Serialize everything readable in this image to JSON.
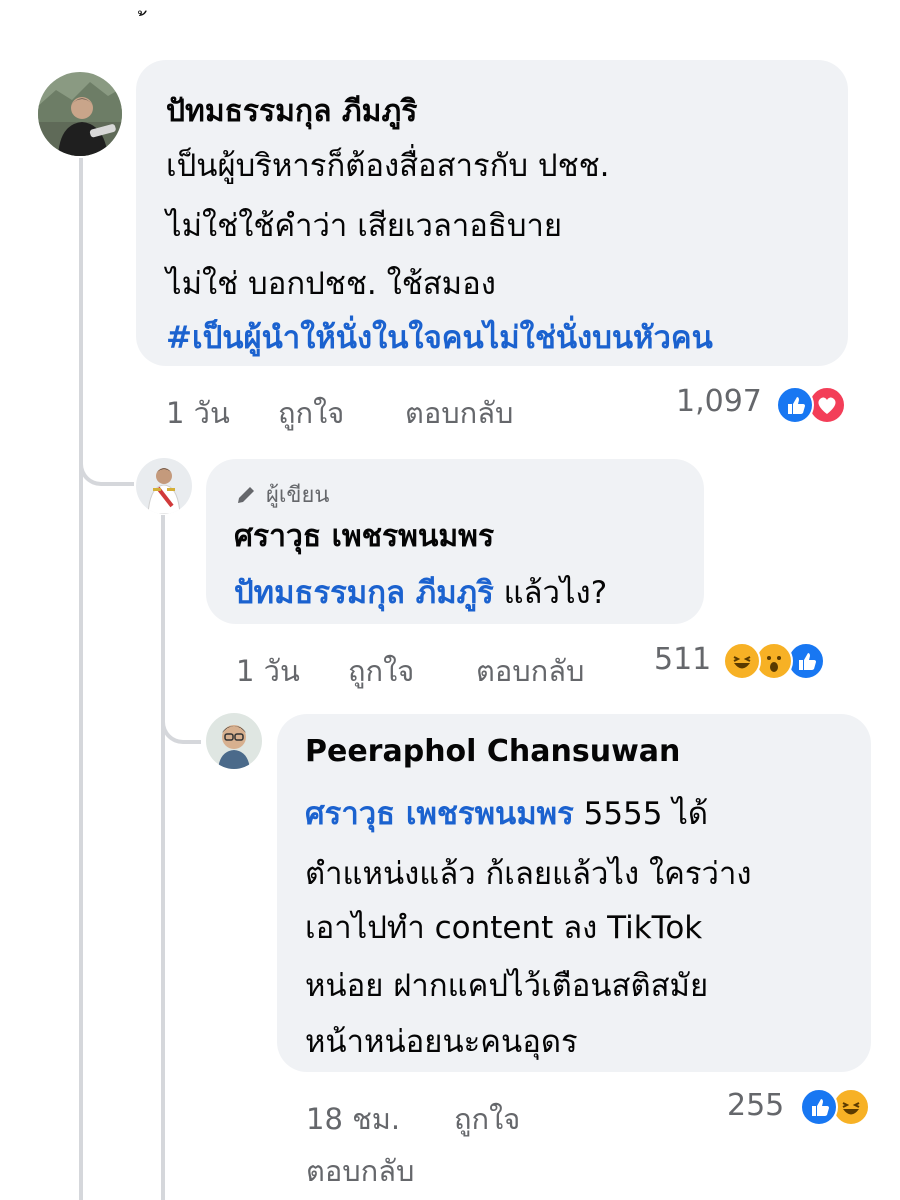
{
  "top_mark": "้",
  "comments": [
    {
      "author": "ปัทมธรรมกุล ภีมภูริ",
      "lines": [
        "เป็นผู้บริหารก็ต้องสื่อสารกับ ปชช.",
        "ไม่ใช่ใช้คำว่า เสียเวลาอธิบาย",
        "ไม่ใช่ บอกปชช. ใช้สมอง"
      ],
      "hashtag": "#เป็นผู้นำให้นั่งในใจคนไม่ใช่นั่งบนหัวคน",
      "time": "1 วัน",
      "like_label": "ถูกใจ",
      "reply_label": "ตอบกลับ",
      "reaction_count": "1,097",
      "reactions": [
        "like-icon",
        "love-icon"
      ]
    },
    {
      "badge": "ผู้เขียน",
      "author": "ศราวุธ เพชรพนมพร",
      "mention": "ปัทมธรรมกุล ภีมภูริ",
      "text": "แล้วไง?",
      "time": "1 วัน",
      "like_label": "ถูกใจ",
      "reply_label": "ตอบกลับ",
      "reaction_count": "511",
      "reactions": [
        "haha-icon",
        "wow-icon",
        "like-icon"
      ]
    },
    {
      "author": "Peeraphol Chansuwan",
      "mention": "ศราวุธ เพชรพนมพร",
      "first_line_rest": "5555 ได้",
      "lines": [
        "ตำแหน่งแล้ว ก้เลยแล้วไง ใครว่าง",
        "เอาไปทำ content ลง TikTok",
        "หน่อย ฝากแคปไว้เตือนสติสมัย",
        "หน้าหน่อยนะคนอุดร"
      ],
      "time": "18 ชม.",
      "like_label": "ถูกใจ",
      "reply_label": "ตอบกลับ",
      "reaction_count": "255",
      "reactions": [
        "like-icon",
        "haha-icon"
      ]
    }
  ],
  "colors": {
    "bubble": "#f0f2f5",
    "link": "#1b62cf",
    "meta": "#65676b",
    "like": "#1877f2",
    "love": "#f33e58",
    "haha": "#f7b125"
  }
}
